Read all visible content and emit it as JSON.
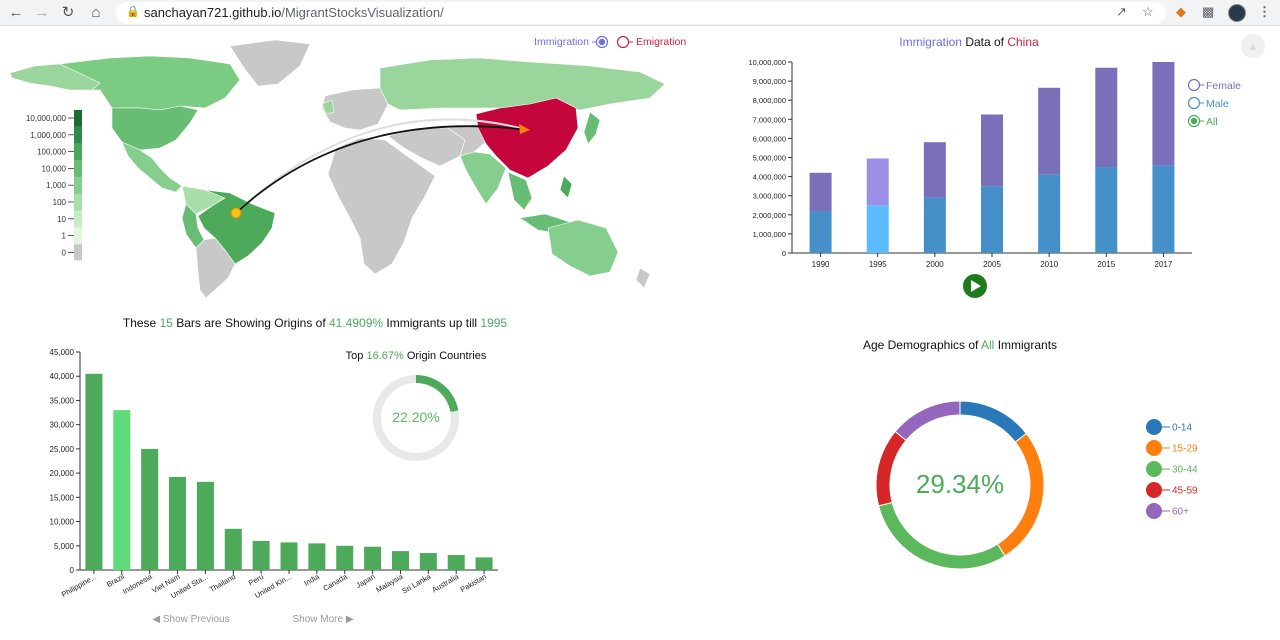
{
  "browser": {
    "url_host": "sanchayan721.github.io",
    "url_path": "/MigrantStocksVisualization/"
  },
  "colors": {
    "immigration": "#6e6ee8",
    "emigration": "#cc2244",
    "green": "#4caa5a",
    "light_green": "#5fdc7a",
    "male": "#4590c9",
    "female": "#7a6fb8",
    "male_highlight": "#5bbcff",
    "female_highlight": "#9d8fe6",
    "china": "#c4063c",
    "land_gray": "#c8c8c8"
  },
  "map": {
    "toggle_immigration": "Immigration",
    "toggle_emigration": "Emigration",
    "selected_mode": "Immigration",
    "legend_labels": [
      "10,000,000",
      "1,000,000",
      "100,000",
      "10,000",
      "1,000",
      "100",
      "10",
      "1",
      "0"
    ],
    "legend_colors": [
      "#1b6b33",
      "#2d8c47",
      "#48a85c",
      "#66bd73",
      "#86ce8e",
      "#a8dea8",
      "#c8ecc6",
      "#e4f5e2",
      "#c8c8c8"
    ],
    "destination": "China",
    "origin": "Brazil"
  },
  "stacked": {
    "title_prefix": "Immigration",
    "title_middle": " Data of ",
    "title_country": "China",
    "legend": [
      "Female",
      "Male",
      "All"
    ],
    "legend_selected": "All",
    "play_icon": "play-icon"
  },
  "top_bars": {
    "title_parts": [
      "These ",
      "15",
      " Bars are Showing Origins of ",
      "41.4909%",
      " Immigrants up till ",
      "1995"
    ],
    "show_previous": "◀ Show Previous",
    "show_more": "Show More ▶"
  },
  "donut_small": {
    "title_parts": [
      "Top ",
      "16.67%",
      " Origin Countries"
    ],
    "center": "22.20%",
    "value": 0.222
  },
  "age": {
    "title_parts": [
      "Age Demographics of ",
      "All",
      " Immigrants"
    ],
    "center": "29.34%"
  },
  "chart_data": [
    {
      "type": "bar",
      "id": "stacked",
      "stacked": true,
      "categories": [
        "1990",
        "1995",
        "2000",
        "2005",
        "2010",
        "2015",
        "2017"
      ],
      "series": [
        {
          "name": "Male",
          "values": [
            2200000,
            2500000,
            2900000,
            3500000,
            4100000,
            4500000,
            4600000
          ]
        },
        {
          "name": "Female",
          "values": [
            2000000,
            2450000,
            2900000,
            3750000,
            4550000,
            5200000,
            5400000
          ]
        }
      ],
      "highlight_category": "1995",
      "ylim": [
        0,
        10000000
      ],
      "yticks": [
        0,
        1000000,
        2000000,
        3000000,
        4000000,
        5000000,
        6000000,
        7000000,
        8000000,
        9000000,
        10000000
      ],
      "ytick_labels": [
        "0",
        "1,000,000",
        "2,000,000",
        "3,000,000",
        "4,000,000",
        "5,000,000",
        "6,000,000",
        "7,000,000",
        "8,000,000",
        "9,000,000",
        "10,000,000"
      ]
    },
    {
      "type": "bar",
      "id": "origins",
      "categories": [
        "Philippine...",
        "Brazil",
        "Indonesia",
        "Viet Nam",
        "United Sta...",
        "Thailand",
        "Peru",
        "United Kin...",
        "India",
        "Canada",
        "Japan",
        "Malaysia",
        "Sri Lanka",
        "Australia",
        "Pakistan"
      ],
      "values": [
        40500,
        33000,
        25000,
        19200,
        18200,
        8500,
        6000,
        5700,
        5500,
        5000,
        4800,
        3900,
        3500,
        3100,
        2600
      ],
      "highlight_category": "Brazil",
      "ylim": [
        0,
        45000
      ],
      "yticks": [
        0,
        5000,
        10000,
        15000,
        20000,
        25000,
        30000,
        35000,
        40000,
        45000
      ],
      "ytick_labels": [
        "0",
        "5,000",
        "10,000",
        "15,000",
        "20,000",
        "25,000",
        "30,000",
        "35,000",
        "40,000",
        "45,000"
      ]
    },
    {
      "type": "pie",
      "id": "age",
      "donut": true,
      "categories": [
        "0-14",
        "15-29",
        "30-44",
        "45-59",
        "60+"
      ],
      "values": [
        14.5,
        26.5,
        30.0,
        15.0,
        14.0
      ],
      "colors": [
        "#2b78b8",
        "#ff7f0e",
        "#5cb85c",
        "#d62728",
        "#9467bd"
      ]
    }
  ]
}
